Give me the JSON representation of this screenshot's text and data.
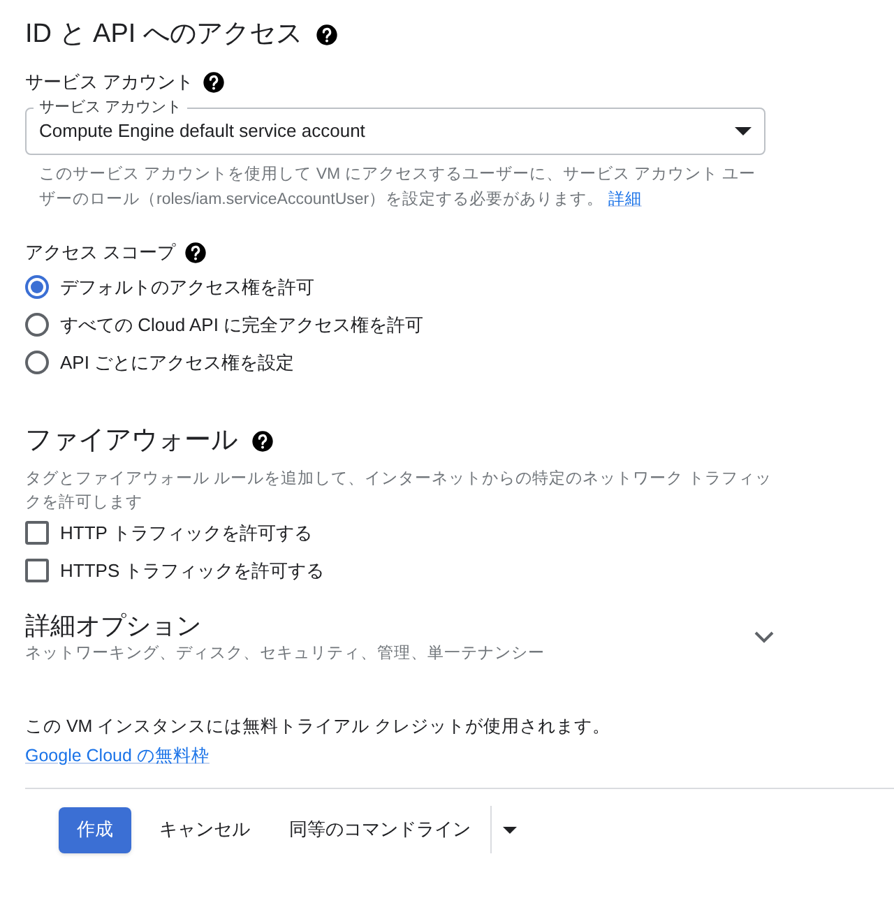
{
  "title": "ID と API へのアクセス",
  "service_account": {
    "heading": "サービス アカウント",
    "field_label": "サービス アカウント",
    "value": "Compute Engine default service account",
    "help": "このサービス アカウントを使用して VM にアクセスするユーザーに、サービス アカウント ユーザーのロール（roles/iam.serviceAccountUser）を設定する必要があります。",
    "help_link": "詳細"
  },
  "access_scope": {
    "heading": "アクセス スコープ",
    "options": [
      {
        "label": "デフォルトのアクセス権を許可",
        "selected": true
      },
      {
        "label": "すべての Cloud API に完全アクセス権を許可",
        "selected": false
      },
      {
        "label": "API ごとにアクセス権を設定",
        "selected": false
      }
    ]
  },
  "firewall": {
    "heading": "ファイアウォール",
    "description": "タグとファイアウォール ルールを追加して、インターネットからの特定のネットワーク トラフィックを許可します",
    "options": [
      {
        "label": "HTTP トラフィックを許可する",
        "checked": false
      },
      {
        "label": "HTTPS トラフィックを許可する",
        "checked": false
      }
    ]
  },
  "advanced": {
    "title": "詳細オプション",
    "subtitle": "ネットワーキング、ディスク、セキュリティ、管理、単一テナンシー",
    "expanded": false
  },
  "notice": {
    "text": "この VM インスタンスには無料トライアル クレジットが使用されます。",
    "link": "Google Cloud の無料枠"
  },
  "buttons": {
    "create": "作成",
    "cancel": "キャンセル",
    "command_line": "同等のコマンドライン"
  }
}
